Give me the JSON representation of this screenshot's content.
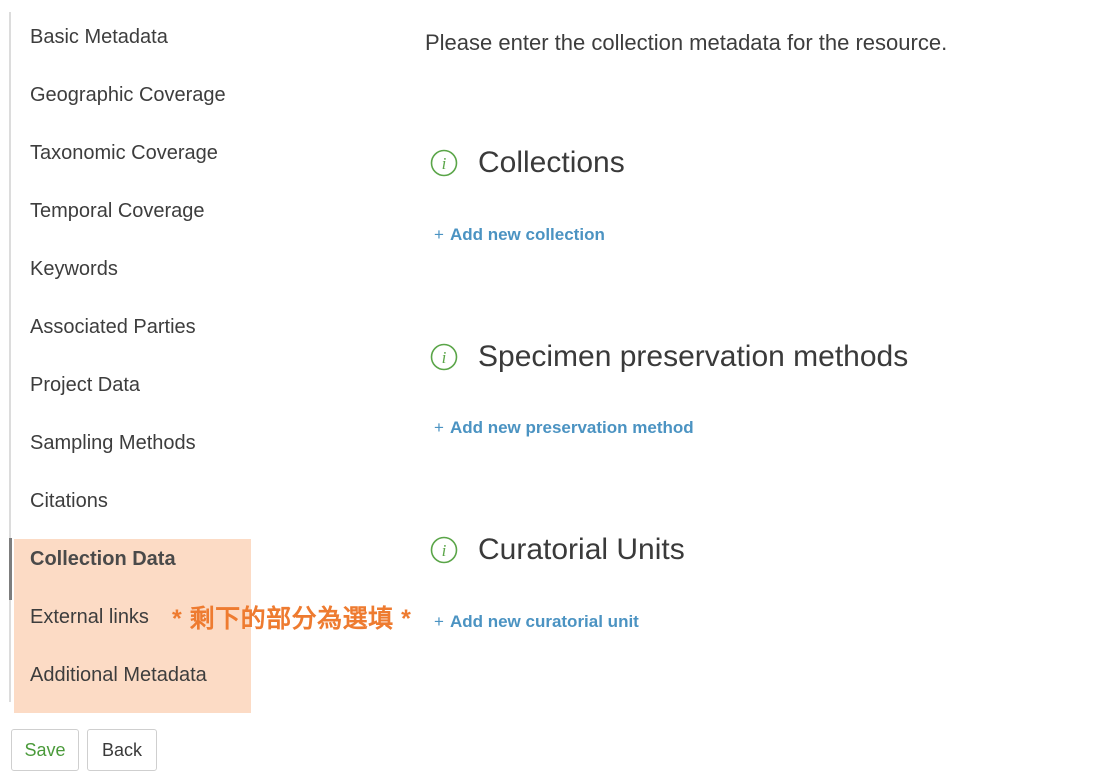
{
  "sidebar": {
    "items": [
      {
        "label": "Basic Metadata"
      },
      {
        "label": "Geographic Coverage"
      },
      {
        "label": "Taxonomic Coverage"
      },
      {
        "label": "Temporal Coverage"
      },
      {
        "label": "Keywords"
      },
      {
        "label": "Associated Parties"
      },
      {
        "label": "Project Data"
      },
      {
        "label": "Sampling Methods"
      },
      {
        "label": "Citations"
      },
      {
        "label": "Collection Data"
      },
      {
        "label": "External links"
      },
      {
        "label": "Additional Metadata"
      }
    ],
    "active_item": "Collection Data"
  },
  "annotation": {
    "note": "* 剩下的部分為選填 *",
    "color": "#ee7b30",
    "highlight_color": "#fabe96"
  },
  "main": {
    "intro": "Please enter the collection metadata for the resource.",
    "sections": [
      {
        "title": "Collections",
        "add_link": "Add new collection",
        "icon": "info-icon"
      },
      {
        "title": "Specimen preservation methods",
        "add_link": "Add new preservation method",
        "icon": "info-icon"
      },
      {
        "title": "Curatorial Units",
        "add_link": "Add new curatorial unit",
        "icon": "info-icon"
      }
    ],
    "add_prefix": "+"
  },
  "footer": {
    "save_label": "Save",
    "back_label": "Back"
  },
  "colors": {
    "link": "#4b93c2",
    "save_text": "#4a9a3a",
    "icon": "#5aa548"
  }
}
